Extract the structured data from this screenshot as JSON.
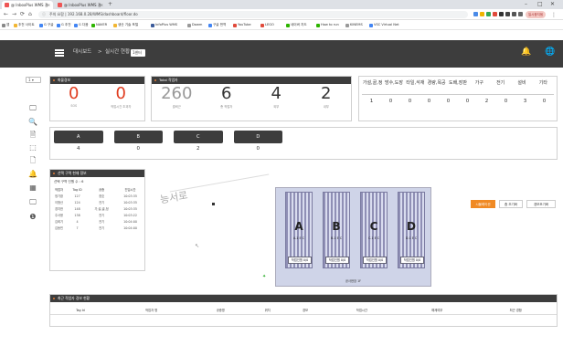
{
  "browser": {
    "tabs": [
      {
        "title": "@ InboxPlus WMS 결",
        "active": true
      },
      {
        "title": "@ InboxPlus WMS 결",
        "active": false
      }
    ],
    "new_tab": "+",
    "window_controls": {
      "minimize": "–",
      "maximize": "□",
      "close": "✕"
    },
    "url": "주의 요함 | 192.168.0.28/WMS/dashboard/floor.do",
    "back": "←",
    "forward": "→",
    "reload": "⟳",
    "home": "⌂",
    "profile": "일시중지됨",
    "bookmarks": [
      "앱",
      "추천 사이트",
      "G 구글",
      "G 추천",
      "G 다음",
      "NAVER",
      "생산 기술 포털",
      "InfoPlus WMS",
      "Dowm",
      "구글 번역",
      "YouTube",
      "LEGO",
      "네이버 지도",
      "How to run",
      "KINEMS",
      "VSC Virtual Net"
    ]
  },
  "header": {
    "breadcrumb_main": "대시보드",
    "breadcrumb_sep": ">",
    "breadcrumb_sub": "실시간 현황",
    "center_select": "1센터",
    "bell_icon": "🔔",
    "globe_icon": "🌐"
  },
  "sidebar": {
    "dropdown": "1 ▾",
    "icons": [
      "monitor-icon",
      "search-icon",
      "document-icon",
      "box-icon",
      "file-icon",
      "bell-icon",
      "table-icon",
      "screen-icon",
      "info-icon"
    ]
  },
  "kpi_alarm": {
    "title": "화물경보",
    "values": [
      {
        "value": "0",
        "label": "SOS"
      },
      {
        "value": "0",
        "label": "작업시간 초과자"
      }
    ]
  },
  "kpi_total": {
    "title": "Total 작업자",
    "values": [
      {
        "value": "260",
        "label": "출퇴근"
      },
      {
        "value": "6",
        "label": "총 작업자"
      },
      {
        "value": "4",
        "label": "외부"
      },
      {
        "value": "2",
        "label": "내부"
      }
    ]
  },
  "work_type": {
    "headers": [
      "가설,골,정",
      "방수,도장",
      "타일,석재",
      "경량,목공",
      "도배,장판",
      "가구",
      "전기",
      "설비",
      "기타"
    ],
    "values": [
      "1",
      "0",
      "0",
      "0",
      "0",
      "0",
      "2",
      "0",
      "3",
      "0"
    ]
  },
  "zones": {
    "headers": [
      "A",
      "B",
      "C",
      "D"
    ],
    "values": [
      "4",
      "0",
      "2",
      "0"
    ]
  },
  "zone_info": {
    "title": "선택 구역 현재 정보",
    "subtitle": "선택 구역 인원 수 : 6",
    "columns": [
      "작업자",
      "Tag ID",
      "공종",
      "진입시간"
    ],
    "rows": [
      [
        "정기환",
        "127",
        "창호",
        "10:03:35"
      ],
      [
        "이형산",
        "124",
        "전기",
        "10:03:35"
      ],
      [
        "경지한",
        "148",
        "가,설,골,정",
        "10:03:35"
      ],
      [
        "주서용",
        "138",
        "전기",
        "10:03:22"
      ],
      [
        "김희기",
        "4",
        "전기",
        "10:04:00"
      ],
      [
        "김동빈",
        "7",
        "전기",
        "10:04:00"
      ]
    ]
  },
  "map": {
    "road_label": "능서로",
    "buttons": [
      "시뮬레이션",
      "줌 초기화",
      "경보조기화"
    ],
    "docks": [
      {
        "letter": "A",
        "sub": "A-1 E C",
        "count": "작업인원 0/0"
      },
      {
        "letter": "B",
        "sub": "B-1 E C",
        "count": "작업인원 0/0"
      },
      {
        "letter": "C",
        "sub": "C-1 E C",
        "count": "작업인원 0/0"
      },
      {
        "letter": "D",
        "sub": "D-1 E C",
        "count": "작업인원 0/0"
      }
    ],
    "building_label": "공사현장 1F"
  },
  "bottom_table": {
    "title": "최근 작업자 경보 현황",
    "columns": [
      "Tag Id",
      "작업자 명",
      "공종명",
      "위치",
      "경보",
      "작업시간",
      "해제여부",
      "최근 경합"
    ]
  },
  "colors": {
    "header_bg": "#3d3d3d",
    "alarm_red": "#e03c1f",
    "accent_orange": "#f08a24"
  }
}
